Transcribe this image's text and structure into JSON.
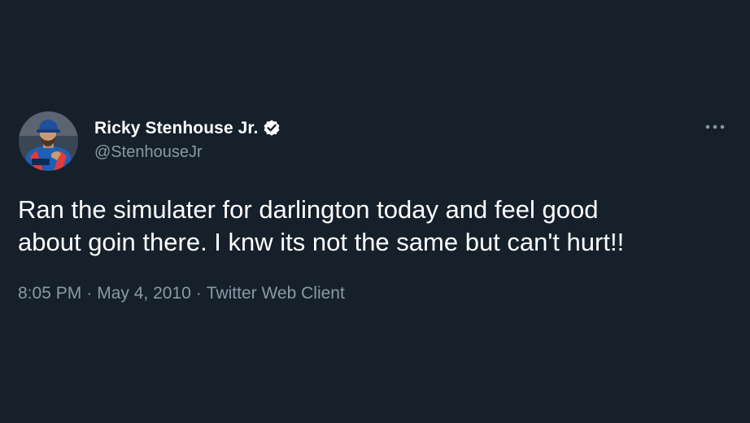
{
  "tweet": {
    "author": {
      "display_name": "Ricky Stenhouse Jr.",
      "handle": "@StenhouseJr",
      "verified": true,
      "avatar_icon": "driver-portrait-avatar"
    },
    "text": "Ran the simulater for darlington today and feel good\nabout goin there. I knw its not the same but can't hurt!!",
    "time": "8:05 PM",
    "separator": "·",
    "date": "May 4, 2010",
    "source": "Twitter Web Client",
    "more_icon": "more-horizontal-icon"
  },
  "colors": {
    "background": "#15202b",
    "text_primary": "#ffffff",
    "text_secondary": "#8b98a5"
  }
}
